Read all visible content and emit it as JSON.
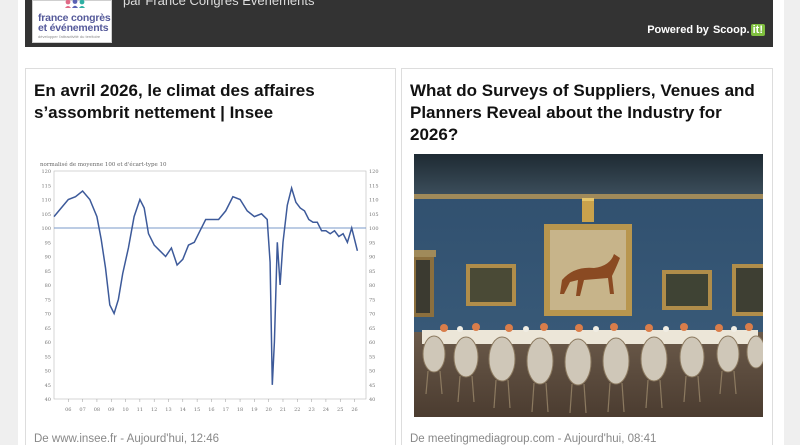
{
  "header": {
    "logo_line1": "france congrès",
    "logo_line2": "et événements",
    "logo_sub": "développer l'attractivité du territoire",
    "curated_by": "par France Congrès Evénements",
    "powered_by": "Powered by",
    "brand": "Scoop.",
    "brand_suffix": "it!"
  },
  "cards": [
    {
      "title": "En avril 2026, le climat des affaires s’assombrit nettement | Insee",
      "source": "De www.insee.fr - Aujourd'hui, 12:46"
    },
    {
      "title": "What do Surveys of Suppliers, Venues and Planners Reveal about the Industry for 2026?",
      "source": "De meetingmediagroup.com - Aujourd'hui, 08:41"
    }
  ],
  "chart_data": {
    "type": "line",
    "title": "",
    "ylabel": "normalisé de moyenne 100 et d'écart-type 10",
    "xlabel": "",
    "ylim": [
      40,
      120
    ],
    "y_ticks": [
      40,
      45,
      50,
      55,
      60,
      65,
      70,
      75,
      80,
      85,
      90,
      95,
      100,
      105,
      110,
      115,
      120
    ],
    "x_ticks": [
      "06",
      "07",
      "08",
      "09",
      "10",
      "11",
      "12",
      "13",
      "14",
      "15",
      "16",
      "17",
      "18",
      "19",
      "20",
      "21",
      "22",
      "23",
      "24",
      "25",
      "26"
    ],
    "reference_line": 100,
    "series": [
      {
        "x": [
          2005.0,
          2005.5,
          2006.0,
          2006.5,
          2007.0,
          2007.5,
          2008.0,
          2008.3,
          2008.6,
          2008.9,
          2009.2,
          2009.5,
          2009.8,
          2010.2,
          2010.6,
          2011.0,
          2011.3,
          2011.6,
          2012.0,
          2012.4,
          2012.8,
          2013.2,
          2013.6,
          2014.0,
          2014.4,
          2014.8,
          2015.2,
          2015.6,
          2016.0,
          2016.5,
          2017.0,
          2017.5,
          2018.0,
          2018.5,
          2019.0,
          2019.5,
          2019.9,
          2020.1,
          2020.25,
          2020.4,
          2020.6,
          2020.8,
          2021.0,
          2021.3,
          2021.6,
          2021.9,
          2022.2,
          2022.5,
          2022.8,
          2023.1,
          2023.4,
          2023.7,
          2024.0,
          2024.3,
          2024.6,
          2024.9,
          2025.2,
          2025.5,
          2025.8,
          2026.2
        ],
        "y": [
          104,
          107,
          110,
          111,
          113,
          110,
          104,
          96,
          86,
          73,
          70,
          75,
          84,
          93,
          104,
          110,
          107,
          98,
          94,
          92,
          90,
          93,
          87,
          89,
          94,
          95,
          99,
          103,
          103,
          103,
          106,
          111,
          110,
          106,
          104,
          105,
          103,
          88,
          45,
          60,
          95,
          80,
          95,
          108,
          114,
          109,
          107,
          106,
          103,
          102,
          102,
          99,
          99,
          98,
          99,
          97,
          98,
          95,
          100,
          92
        ]
      }
    ]
  },
  "colors": {
    "topbar": "#333333",
    "series_line": "#3d5a9a",
    "reference_line": "#7a98c8",
    "scoopit_green": "#7fbf3f"
  }
}
